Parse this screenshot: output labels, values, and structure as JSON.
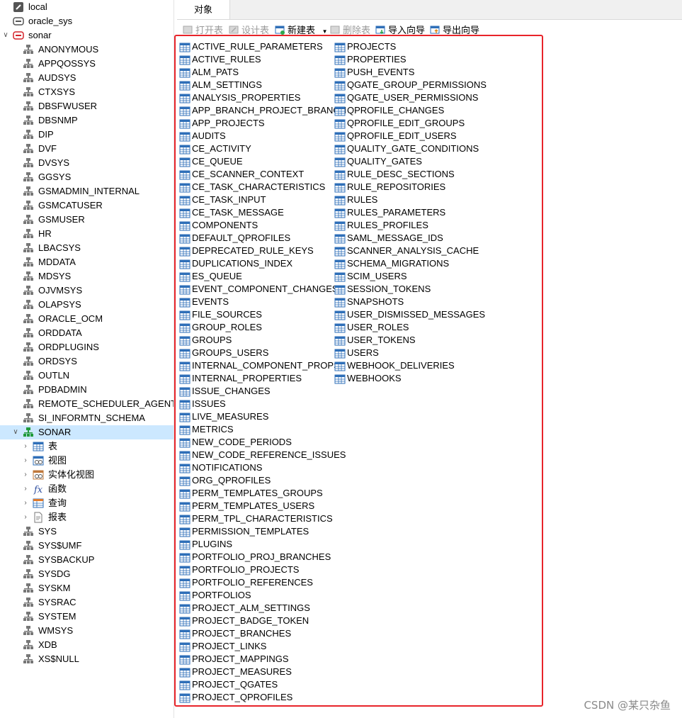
{
  "tree": {
    "connections": [
      {
        "label": "local",
        "icon": "connection-icon"
      },
      {
        "label": "oracle_sys",
        "icon": "db-connection-icon"
      },
      {
        "label": "sonar",
        "icon": "oracle-connection-icon"
      }
    ],
    "schemas": [
      "ANONYMOUS",
      "APPQOSSYS",
      "AUDSYS",
      "CTXSYS",
      "DBSFWUSER",
      "DBSNMP",
      "DIP",
      "DVF",
      "DVSYS",
      "GGSYS",
      "GSMADMIN_INTERNAL",
      "GSMCATUSER",
      "GSMUSER",
      "HR",
      "LBACSYS",
      "MDDATA",
      "MDSYS",
      "OJVMSYS",
      "OLAPSYS",
      "ORACLE_OCM",
      "ORDDATA",
      "ORDPLUGINS",
      "ORDSYS",
      "OUTLN",
      "PDBADMIN",
      "REMOTE_SCHEDULER_AGENT",
      "SI_INFORMTN_SCHEMA"
    ],
    "selected_schema": "SONAR",
    "sonar_children": [
      {
        "label": "表",
        "icon": "table-icon"
      },
      {
        "label": "视图",
        "icon": "view-icon"
      },
      {
        "label": "实体化视图",
        "icon": "materialized-view-icon"
      },
      {
        "label": "函数",
        "icon": "function-icon"
      },
      {
        "label": "查询",
        "icon": "query-icon"
      },
      {
        "label": "报表",
        "icon": "report-icon"
      }
    ],
    "schemas_after": [
      "SYS",
      "SYS$UMF",
      "SYSBACKUP",
      "SYSDG",
      "SYSKM",
      "SYSRAC",
      "SYSTEM",
      "WMSYS",
      "XDB",
      "XS$NULL"
    ]
  },
  "tabs": {
    "objects": "对象"
  },
  "toolbar": {
    "open": "打开表",
    "design": "设计表",
    "new": "新建表",
    "delete": "删除表",
    "import": "导入向导",
    "export": "导出向导"
  },
  "tables_col1": [
    "ACTIVE_RULE_PARAMETERS",
    "ACTIVE_RULES",
    "ALM_PATS",
    "ALM_SETTINGS",
    "ANALYSIS_PROPERTIES",
    "APP_BRANCH_PROJECT_BRANCH",
    "APP_PROJECTS",
    "AUDITS",
    "CE_ACTIVITY",
    "CE_QUEUE",
    "CE_SCANNER_CONTEXT",
    "CE_TASK_CHARACTERISTICS",
    "CE_TASK_INPUT",
    "CE_TASK_MESSAGE",
    "COMPONENTS",
    "DEFAULT_QPROFILES",
    "DEPRECATED_RULE_KEYS",
    "DUPLICATIONS_INDEX",
    "ES_QUEUE",
    "EVENT_COMPONENT_CHANGES",
    "EVENTS",
    "FILE_SOURCES",
    "GROUP_ROLES",
    "GROUPS",
    "GROUPS_USERS",
    "INTERNAL_COMPONENT_PROPS",
    "INTERNAL_PROPERTIES",
    "ISSUE_CHANGES",
    "ISSUES",
    "LIVE_MEASURES",
    "METRICS",
    "NEW_CODE_PERIODS",
    "NEW_CODE_REFERENCE_ISSUES",
    "NOTIFICATIONS",
    "ORG_QPROFILES",
    "PERM_TEMPLATES_GROUPS",
    "PERM_TEMPLATES_USERS",
    "PERM_TPL_CHARACTERISTICS",
    "PERMISSION_TEMPLATES",
    "PLUGINS",
    "PORTFOLIO_PROJ_BRANCHES",
    "PORTFOLIO_PROJECTS",
    "PORTFOLIO_REFERENCES",
    "PORTFOLIOS",
    "PROJECT_ALM_SETTINGS",
    "PROJECT_BADGE_TOKEN",
    "PROJECT_BRANCHES",
    "PROJECT_LINKS",
    "PROJECT_MAPPINGS",
    "PROJECT_MEASURES",
    "PROJECT_QGATES",
    "PROJECT_QPROFILES"
  ],
  "tables_col2": [
    "PROJECTS",
    "PROPERTIES",
    "PUSH_EVENTS",
    "QGATE_GROUP_PERMISSIONS",
    "QGATE_USER_PERMISSIONS",
    "QPROFILE_CHANGES",
    "QPROFILE_EDIT_GROUPS",
    "QPROFILE_EDIT_USERS",
    "QUALITY_GATE_CONDITIONS",
    "QUALITY_GATES",
    "RULE_DESC_SECTIONS",
    "RULE_REPOSITORIES",
    "RULES",
    "RULES_PARAMETERS",
    "RULES_PROFILES",
    "SAML_MESSAGE_IDS",
    "SCANNER_ANALYSIS_CACHE",
    "SCHEMA_MIGRATIONS",
    "SCIM_USERS",
    "SESSION_TOKENS",
    "SNAPSHOTS",
    "USER_DISMISSED_MESSAGES",
    "USER_ROLES",
    "USER_TOKENS",
    "USERS",
    "WEBHOOK_DELIVERIES",
    "WEBHOOKS"
  ],
  "watermark": "CSDN @某只杂鱼",
  "colors": {
    "highlight": "#e8242a",
    "selected": "#cce8ff",
    "table_icon": "#2f6fb8"
  }
}
